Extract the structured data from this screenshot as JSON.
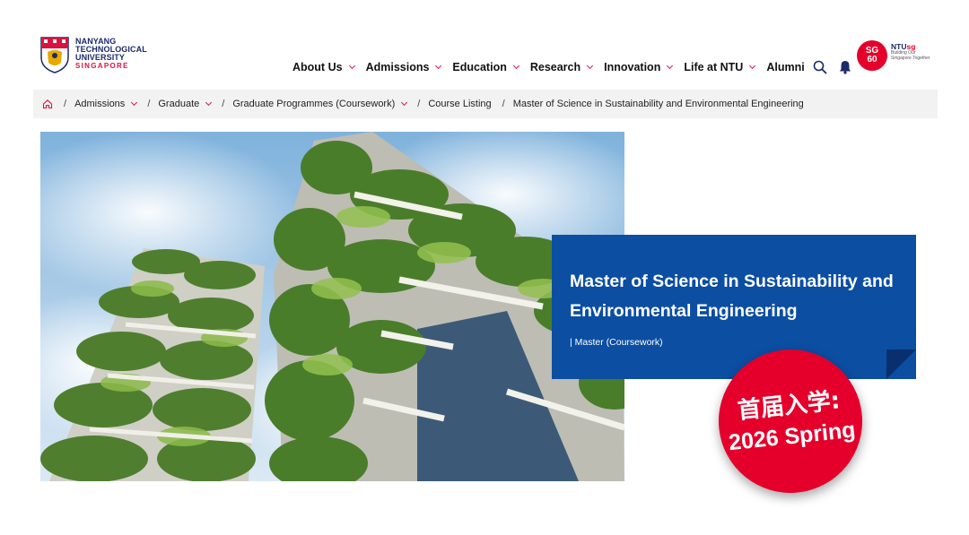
{
  "logo": {
    "line1": "NANYANG",
    "line2": "TECHNOLOGICAL",
    "line3": "UNIVERSITY",
    "line4": "SINGAPORE"
  },
  "nav": {
    "items": [
      {
        "label": "About Us",
        "has_dropdown": true
      },
      {
        "label": "Admissions",
        "has_dropdown": true
      },
      {
        "label": "Education",
        "has_dropdown": true
      },
      {
        "label": "Research",
        "has_dropdown": true
      },
      {
        "label": "Innovation",
        "has_dropdown": true
      },
      {
        "label": "Life at NTU",
        "has_dropdown": true
      },
      {
        "label": "Alumni",
        "has_dropdown": false
      }
    ],
    "icons": [
      "search-icon",
      "bell-icon"
    ]
  },
  "sg60": {
    "badge_top": "SG",
    "badge_bottom": "60",
    "brand_prefix": "NTU",
    "brand_suffix": "sg",
    "tagline": "Building Our Singapore Together"
  },
  "breadcrumb": {
    "items": [
      {
        "label": "Admissions",
        "has_dropdown": true
      },
      {
        "label": "Graduate",
        "has_dropdown": true
      },
      {
        "label": "Graduate Programmes (Coursework)",
        "has_dropdown": true
      },
      {
        "label": "Course Listing",
        "has_dropdown": false
      },
      {
        "label": "Master of Science in Sustainability and Environmental Engineering",
        "has_dropdown": false
      }
    ]
  },
  "hero": {
    "title_line1": "Master of Science in Sustainability and",
    "title_line2": "Environmental Engineering",
    "subtitle": "| Master (Coursework)",
    "badge_line1": "首届入学:",
    "badge_line2": "2026 Spring"
  },
  "colors": {
    "brand_blue": "#1b2a6b",
    "accent_red": "#d71440",
    "card_blue": "#0c4ea2",
    "badge_red": "#e4002b"
  }
}
